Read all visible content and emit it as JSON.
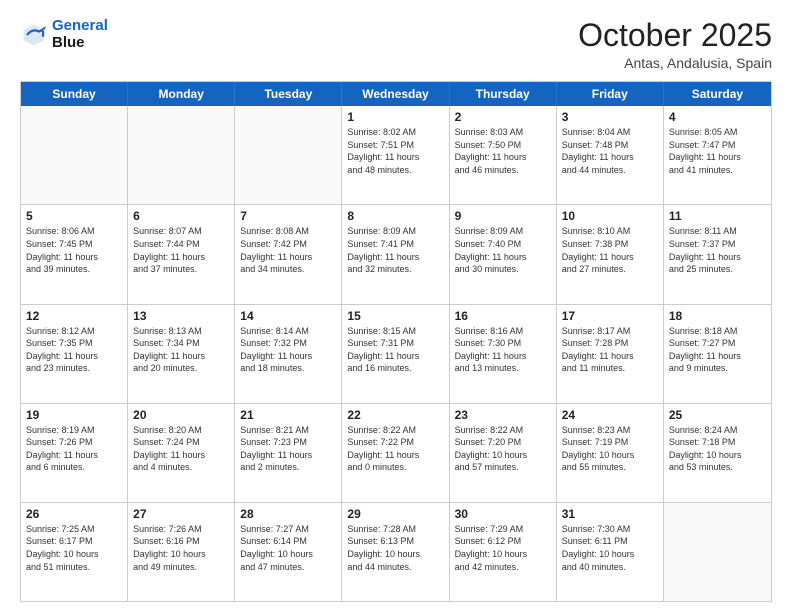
{
  "header": {
    "logo_line1": "General",
    "logo_line2": "Blue",
    "month_title": "October 2025",
    "location": "Antas, Andalusia, Spain"
  },
  "days_of_week": [
    "Sunday",
    "Monday",
    "Tuesday",
    "Wednesday",
    "Thursday",
    "Friday",
    "Saturday"
  ],
  "weeks": [
    [
      {
        "day": "",
        "info": ""
      },
      {
        "day": "",
        "info": ""
      },
      {
        "day": "",
        "info": ""
      },
      {
        "day": "1",
        "info": "Sunrise: 8:02 AM\nSunset: 7:51 PM\nDaylight: 11 hours\nand 48 minutes."
      },
      {
        "day": "2",
        "info": "Sunrise: 8:03 AM\nSunset: 7:50 PM\nDaylight: 11 hours\nand 46 minutes."
      },
      {
        "day": "3",
        "info": "Sunrise: 8:04 AM\nSunset: 7:48 PM\nDaylight: 11 hours\nand 44 minutes."
      },
      {
        "day": "4",
        "info": "Sunrise: 8:05 AM\nSunset: 7:47 PM\nDaylight: 11 hours\nand 41 minutes."
      }
    ],
    [
      {
        "day": "5",
        "info": "Sunrise: 8:06 AM\nSunset: 7:45 PM\nDaylight: 11 hours\nand 39 minutes."
      },
      {
        "day": "6",
        "info": "Sunrise: 8:07 AM\nSunset: 7:44 PM\nDaylight: 11 hours\nand 37 minutes."
      },
      {
        "day": "7",
        "info": "Sunrise: 8:08 AM\nSunset: 7:42 PM\nDaylight: 11 hours\nand 34 minutes."
      },
      {
        "day": "8",
        "info": "Sunrise: 8:09 AM\nSunset: 7:41 PM\nDaylight: 11 hours\nand 32 minutes."
      },
      {
        "day": "9",
        "info": "Sunrise: 8:09 AM\nSunset: 7:40 PM\nDaylight: 11 hours\nand 30 minutes."
      },
      {
        "day": "10",
        "info": "Sunrise: 8:10 AM\nSunset: 7:38 PM\nDaylight: 11 hours\nand 27 minutes."
      },
      {
        "day": "11",
        "info": "Sunrise: 8:11 AM\nSunset: 7:37 PM\nDaylight: 11 hours\nand 25 minutes."
      }
    ],
    [
      {
        "day": "12",
        "info": "Sunrise: 8:12 AM\nSunset: 7:35 PM\nDaylight: 11 hours\nand 23 minutes."
      },
      {
        "day": "13",
        "info": "Sunrise: 8:13 AM\nSunset: 7:34 PM\nDaylight: 11 hours\nand 20 minutes."
      },
      {
        "day": "14",
        "info": "Sunrise: 8:14 AM\nSunset: 7:32 PM\nDaylight: 11 hours\nand 18 minutes."
      },
      {
        "day": "15",
        "info": "Sunrise: 8:15 AM\nSunset: 7:31 PM\nDaylight: 11 hours\nand 16 minutes."
      },
      {
        "day": "16",
        "info": "Sunrise: 8:16 AM\nSunset: 7:30 PM\nDaylight: 11 hours\nand 13 minutes."
      },
      {
        "day": "17",
        "info": "Sunrise: 8:17 AM\nSunset: 7:28 PM\nDaylight: 11 hours\nand 11 minutes."
      },
      {
        "day": "18",
        "info": "Sunrise: 8:18 AM\nSunset: 7:27 PM\nDaylight: 11 hours\nand 9 minutes."
      }
    ],
    [
      {
        "day": "19",
        "info": "Sunrise: 8:19 AM\nSunset: 7:26 PM\nDaylight: 11 hours\nand 6 minutes."
      },
      {
        "day": "20",
        "info": "Sunrise: 8:20 AM\nSunset: 7:24 PM\nDaylight: 11 hours\nand 4 minutes."
      },
      {
        "day": "21",
        "info": "Sunrise: 8:21 AM\nSunset: 7:23 PM\nDaylight: 11 hours\nand 2 minutes."
      },
      {
        "day": "22",
        "info": "Sunrise: 8:22 AM\nSunset: 7:22 PM\nDaylight: 11 hours\nand 0 minutes."
      },
      {
        "day": "23",
        "info": "Sunrise: 8:22 AM\nSunset: 7:20 PM\nDaylight: 10 hours\nand 57 minutes."
      },
      {
        "day": "24",
        "info": "Sunrise: 8:23 AM\nSunset: 7:19 PM\nDaylight: 10 hours\nand 55 minutes."
      },
      {
        "day": "25",
        "info": "Sunrise: 8:24 AM\nSunset: 7:18 PM\nDaylight: 10 hours\nand 53 minutes."
      }
    ],
    [
      {
        "day": "26",
        "info": "Sunrise: 7:25 AM\nSunset: 6:17 PM\nDaylight: 10 hours\nand 51 minutes."
      },
      {
        "day": "27",
        "info": "Sunrise: 7:26 AM\nSunset: 6:16 PM\nDaylight: 10 hours\nand 49 minutes."
      },
      {
        "day": "28",
        "info": "Sunrise: 7:27 AM\nSunset: 6:14 PM\nDaylight: 10 hours\nand 47 minutes."
      },
      {
        "day": "29",
        "info": "Sunrise: 7:28 AM\nSunset: 6:13 PM\nDaylight: 10 hours\nand 44 minutes."
      },
      {
        "day": "30",
        "info": "Sunrise: 7:29 AM\nSunset: 6:12 PM\nDaylight: 10 hours\nand 42 minutes."
      },
      {
        "day": "31",
        "info": "Sunrise: 7:30 AM\nSunset: 6:11 PM\nDaylight: 10 hours\nand 40 minutes."
      },
      {
        "day": "",
        "info": ""
      }
    ]
  ]
}
